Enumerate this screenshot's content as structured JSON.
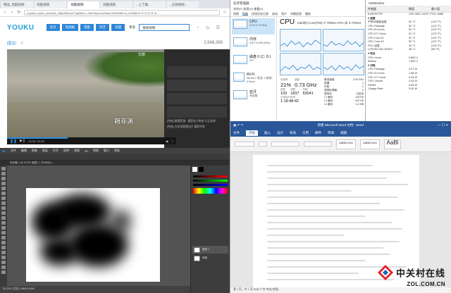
{
  "browser": {
    "tabs": [
      "精品_优酷视频",
      "优酷视频",
      "·优酷视频",
      "优酷视频",
      "...上下集...",
      "...正版视频..."
    ],
    "url": "v.youku.com/v_show/id_XMjc0NDcxOTgwMA==.html?spm=a2hww.20022069.m_223465.5~5~5~5~5~A",
    "logo": "YOUKU",
    "nav": [
      "首页",
      "电视剧",
      "电影",
      "综艺",
      "动漫"
    ],
    "more_btn": "更多",
    "search_placeholder": "搜索视频",
    "title_prefix": "[国宝]",
    "view_count": "2,548,393",
    "subtitle": "藉菲渊",
    "player_logo": "优酷",
    "time_display": "11:00 / 30:37",
    "progress": 0.36,
    "side_caption_1": "[完结] 紫霞菲渊：藉菲仙子绝恋·凡尘仙缘",
    "side_caption_2": "[完结] 大妖怪狐狸仙子·藉菲传奇"
  },
  "taskmgr": {
    "title": "任务管理器",
    "menu": "文件(F)  选项(O)  查看(V)",
    "tabs": [
      "进程",
      "性能",
      "应用历史记录",
      "启动",
      "用户",
      "详细信息",
      "服务"
    ],
    "items": [
      {
        "name": "CPU",
        "sub": "21%  0.73 GHz"
      },
      {
        "name": "内存",
        "sub": "3.6/7.8 GB (46%)"
      },
      {
        "name": "磁盘 0 (C: D:)",
        "sub": "0%"
      },
      {
        "name": "Wi-Fi",
        "sub": "WLAN 2 发送: 0 接收: 0 Kbps"
      },
      {
        "name": "蓝牙",
        "sub": "未连接"
      }
    ],
    "cpu_label": "CPU",
    "cpu_model": "Intel(R) Core(TM) i7-7500U CPU @ 2.70GHz",
    "util_label": "利用率",
    "util": "21%",
    "speed_label": "速度",
    "speed": "0.73 GHz",
    "proc_label": "进程",
    "procs": "103",
    "threads_label": "线程",
    "threads": "1837",
    "handles_label": "句柄",
    "handles": "53041",
    "uptime_label": "正常运行时间",
    "uptime": "1:18:48:42",
    "specs": [
      [
        "基准速度:",
        "2.90 GHz"
      ],
      [
        "插槽:",
        "1"
      ],
      [
        "内核:",
        "2"
      ],
      [
        "逻辑处理器:",
        "4"
      ],
      [
        "虚拟化:",
        "已启用"
      ],
      [
        "L1 缓存:",
        "128 KB"
      ],
      [
        "L2 缓存:",
        "512 KB"
      ],
      [
        "L3 缓存:",
        "4.0 MB"
      ]
    ]
  },
  "hwmon": {
    "title": "HWMonitor",
    "columns": [
      "传感器",
      "数值",
      "最小值"
    ],
    "rows": [
      {
        "n": "▾ 温度",
        "v": "",
        "m": "",
        "sec": true
      },
      {
        "n": "  中央处理器温度",
        "v": "52 °C",
        "m": "(124 °F)"
      },
      {
        "n": "  CPU Package",
        "v": "52 °C",
        "m": "(124 °F)"
      },
      {
        "n": "  CPU IA Cores",
        "v": "52 °C",
        "m": "(124 °F)"
      },
      {
        "n": "  CPU GT Cores",
        "v": "51 °C",
        "m": "(123 °F)"
      },
      {
        "n": "  CPU Core #1",
        "v": "52 °C",
        "m": "(124 °F)"
      },
      {
        "n": "  CPU Core #2",
        "v": "50 °C",
        "m": "(122 °F)"
      },
      {
        "n": "  PCH 温度",
        "v": "43 °C",
        "m": "(109 °F)"
      },
      {
        "n": "  LITEON CB1-SD512",
        "v": "36 °C",
        "m": "(96 °F)"
      },
      {
        "n": "▾ 电压",
        "v": "",
        "m": "",
        "sec": true
      },
      {
        "n": "  CPU Vcore",
        "v": "0.860 V",
        "m": ""
      },
      {
        "n": "  Battery",
        "v": "7.660 V",
        "m": ""
      },
      {
        "n": "▾ 功耗",
        "v": "",
        "m": "",
        "sec": true
      },
      {
        "n": "  CPU Package",
        "v": "4.37 W",
        "m": ""
      },
      {
        "n": "  CPU IA Cores",
        "v": "1.68 W",
        "m": ""
      },
      {
        "n": "  CPU GT Cores",
        "v": "0.05 W",
        "m": ""
      },
      {
        "n": "  CPU Uncore",
        "v": "2.04 W",
        "m": ""
      },
      {
        "n": "  DRAM",
        "v": "0.59 W",
        "m": ""
      },
      {
        "n": "  Charge Rate",
        "v": "0.00 W",
        "m": ""
      }
    ],
    "device": "CPU NEO, ACPI, PCI0, SMB"
  },
  "word": {
    "title": "新建 Microsoft Word 文档 - Word",
    "tabs": [
      "文件",
      "开始",
      "插入",
      "设计",
      "布局",
      "引用",
      "邮件",
      "审阅",
      "视图"
    ],
    "styles": [
      "AaBbCcDc",
      "AaBbCcDc",
      "AaBl"
    ],
    "status": "第 1 页，共 1 页   6932 个字   中文(中国)"
  },
  "ps": {
    "logo": "Ps",
    "menu": [
      "文件",
      "编辑",
      "图像",
      "图层",
      "文字",
      "选择",
      "滤镜",
      "3D",
      "视图",
      "窗口",
      "帮助"
    ],
    "doc_tab": "未标题-1 @ 33.3% (图层 1, RGB/8#) ×",
    "layers": [
      "图层 1",
      "背景"
    ],
    "status": "33.33%   文档:1.88M/4.68M"
  },
  "watermark": {
    "cn": "中关村在线",
    "en": "ZOL.COM.CN"
  },
  "colors": {
    "youku_blue": "#2f86d6",
    "word_blue": "#2b579a",
    "tm_blue": "#1979ca",
    "ps_dark": "#535353"
  }
}
